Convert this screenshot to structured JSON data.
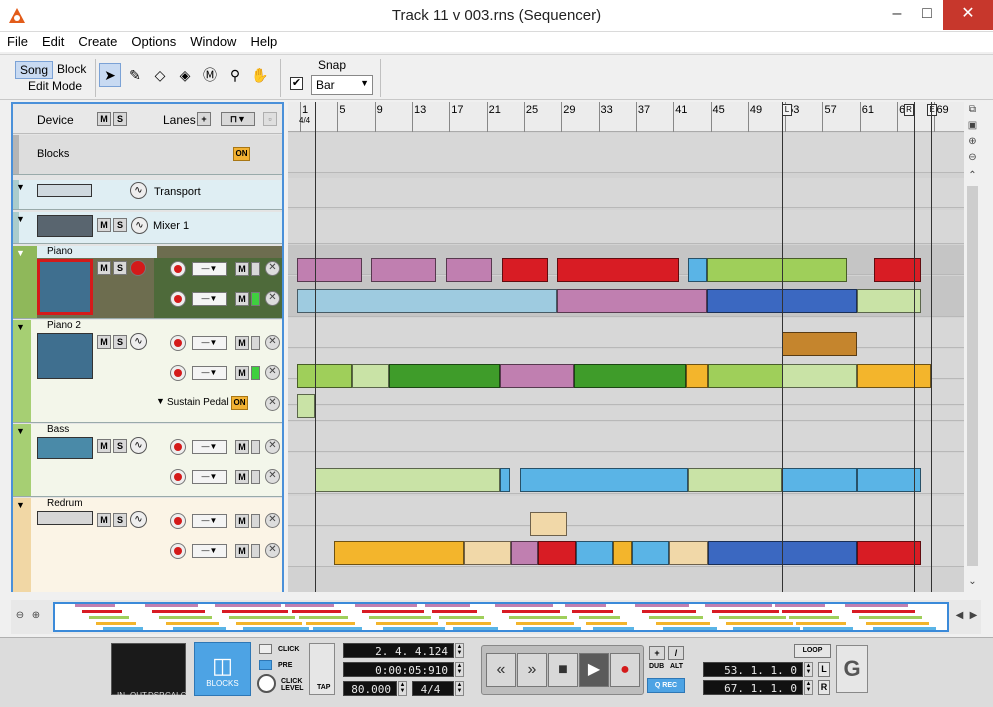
{
  "window": {
    "title": "Track 11 v 003.rns (Sequencer)",
    "minimize": "–",
    "maximize": "□",
    "close": "✕"
  },
  "menu": [
    "File",
    "Edit",
    "Create",
    "Options",
    "Window",
    "Help"
  ],
  "toolbar": {
    "edit_mode": {
      "song": "Song",
      "block": "Block",
      "label": "Edit Mode"
    },
    "tools": [
      "arrow-tool-icon",
      "pencil-tool-icon",
      "eraser-tool-icon",
      "razor-tool-icon",
      "mute-tool-icon",
      "magnify-tool-icon",
      "hand-tool-icon"
    ],
    "snap": {
      "label": "Snap",
      "checked": true,
      "value": "Bar"
    }
  },
  "tracklist": {
    "header": {
      "device": "Device",
      "lanes": "Lanes",
      "m": "M",
      "s": "S"
    },
    "blocks": {
      "label": "Blocks",
      "on": "ON"
    },
    "transport": "Transport",
    "mixer": "Mixer 1",
    "tracks": [
      {
        "name": "Piano"
      },
      {
        "name": "Piano 2",
        "automation": "Sustain Pedal",
        "on": "ON"
      },
      {
        "name": "Bass"
      },
      {
        "name": "Redrum"
      }
    ]
  },
  "ruler": {
    "time_signature": "4/4",
    "bars": [
      "1",
      "5",
      "9",
      "13",
      "17",
      "21",
      "25",
      "29",
      "33",
      "37",
      "41",
      "45",
      "49",
      "53",
      "57",
      "61",
      "65",
      "69"
    ],
    "markers": {
      "left": "L",
      "right": "R",
      "end": "E"
    }
  },
  "transport_panel": {
    "meter_labels": [
      "IN",
      "OUT",
      "DSP",
      "CALC"
    ],
    "blocks": "BLOCKS",
    "click": "CLICK",
    "pre": "PRE",
    "click_level": "CLICK LEVEL",
    "tap": "TAP",
    "position": "2. 4. 4.124",
    "time": "0:00:05:910",
    "tempo": "80.000",
    "signature": "4/4",
    "dub": "DUB",
    "alt": "ALT",
    "qrec": "Q REC",
    "loop": "LOOP",
    "left_locator": "53. 1. 1.   0",
    "right_locator": "67. 1. 1.   0",
    "l": "L",
    "r": "R"
  },
  "colors": {
    "pink": "#c07fb0",
    "red": "#d81c24",
    "lightblue": "#5ab4e6",
    "green": "#9fcf5a",
    "darkgreen": "#3f9c2a",
    "orange": "#f3b52c",
    "peach": "#f1d8a8",
    "brown": "#c5852d",
    "blue": "#3b68c1",
    "selection": "#4a90d9"
  }
}
